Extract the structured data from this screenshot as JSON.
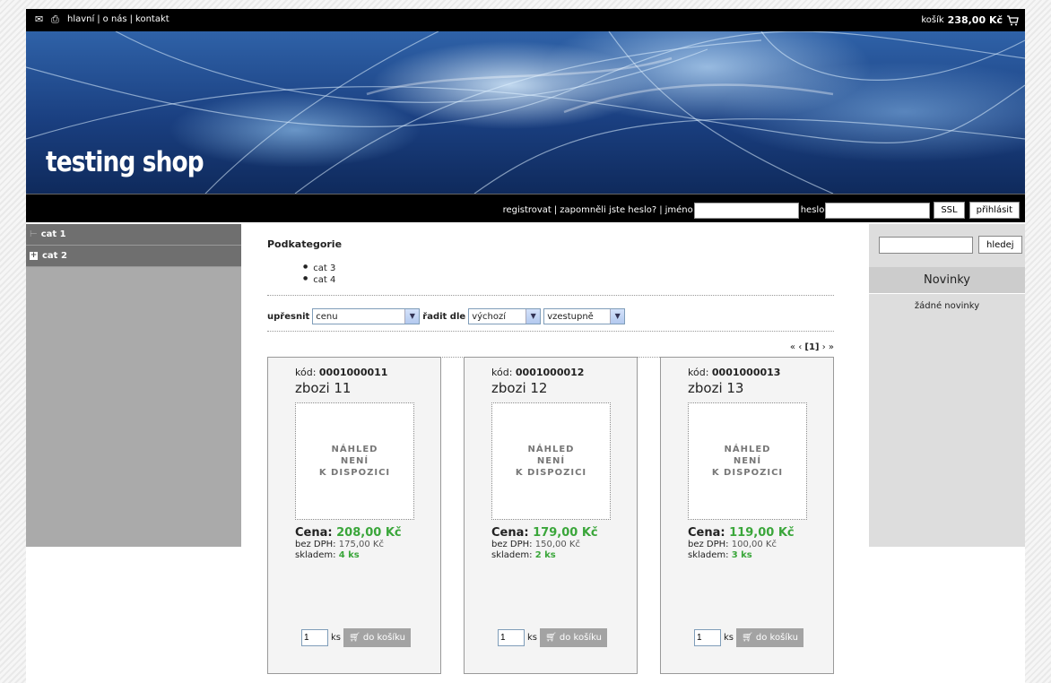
{
  "topbar": {
    "icons": [
      "envelope-icon",
      "printer-icon"
    ],
    "nav": [
      "hlavní",
      "o nás",
      "kontakt"
    ],
    "cart_label": "košík",
    "cart_total": "238,00 Kč",
    "cart_icon": "cart-icon"
  },
  "banner": {
    "logo_text": "testing shop"
  },
  "login": {
    "register": "registrovat",
    "forgot": "zapomněli jste heslo?",
    "name_label": "jméno",
    "password_label": "heslo",
    "name_value": "",
    "password_value": "",
    "ssl_button": "SSL",
    "login_button": "přihlásit"
  },
  "sidebar": {
    "items": [
      {
        "label": "cat 1",
        "icon": "tree-line-icon"
      },
      {
        "label": "cat 2",
        "icon": "expand-plus-icon"
      }
    ]
  },
  "main": {
    "subcategories_title": "Podkategorie",
    "subcategories": [
      "cat 3",
      "cat 4"
    ],
    "filter_label": "upřesnit",
    "filter_value": "cenu",
    "sort_label": "řadit dle",
    "sort_value": "výchozí",
    "order_value": "vzestupně",
    "pager": {
      "prev_first": "«",
      "prev": "‹",
      "current": "[1]",
      "next": "›",
      "next_last": "»"
    }
  },
  "products": [
    {
      "code_label": "kód:",
      "code": "0001000011",
      "name": "zbozi 11",
      "image_text": [
        "NÁHLED",
        "NENÍ",
        "K DISPOZICI"
      ],
      "price_label": "Cena:",
      "price": "208,00 Kč",
      "net_label": "bez DPH:",
      "net_price": "175,00 Kč",
      "stock_label": "skladem:",
      "stock": "4 ks",
      "qty": "1",
      "qty_unit": "ks",
      "buy_label": "do košíku"
    },
    {
      "code_label": "kód:",
      "code": "0001000012",
      "name": "zbozi 12",
      "image_text": [
        "NÁHLED",
        "NENÍ",
        "K DISPOZICI"
      ],
      "price_label": "Cena:",
      "price": "179,00 Kč",
      "net_label": "bez DPH:",
      "net_price": "150,00 Kč",
      "stock_label": "skladem:",
      "stock": "2 ks",
      "qty": "1",
      "qty_unit": "ks",
      "buy_label": "do košíku"
    },
    {
      "code_label": "kód:",
      "code": "0001000013",
      "name": "zbozi 13",
      "image_text": [
        "NÁHLED",
        "NENÍ",
        "K DISPOZICI"
      ],
      "price_label": "Cena:",
      "price": "119,00 Kč",
      "net_label": "bez DPH:",
      "net_price": "100,00 Kč",
      "stock_label": "skladem:",
      "stock": "3 ks",
      "qty": "1",
      "qty_unit": "ks",
      "buy_label": "do košíku"
    }
  ],
  "right": {
    "search_value": "",
    "search_button": "hledej",
    "news_title": "Novinky",
    "news_empty": "žádné novinky"
  },
  "colors": {
    "price_green": "#3aa63a",
    "bar_black": "#000000",
    "sidebar_gray": "#aaaaaa",
    "category_gray": "#6f6f6f",
    "button_gray": "#a3a3a3"
  }
}
